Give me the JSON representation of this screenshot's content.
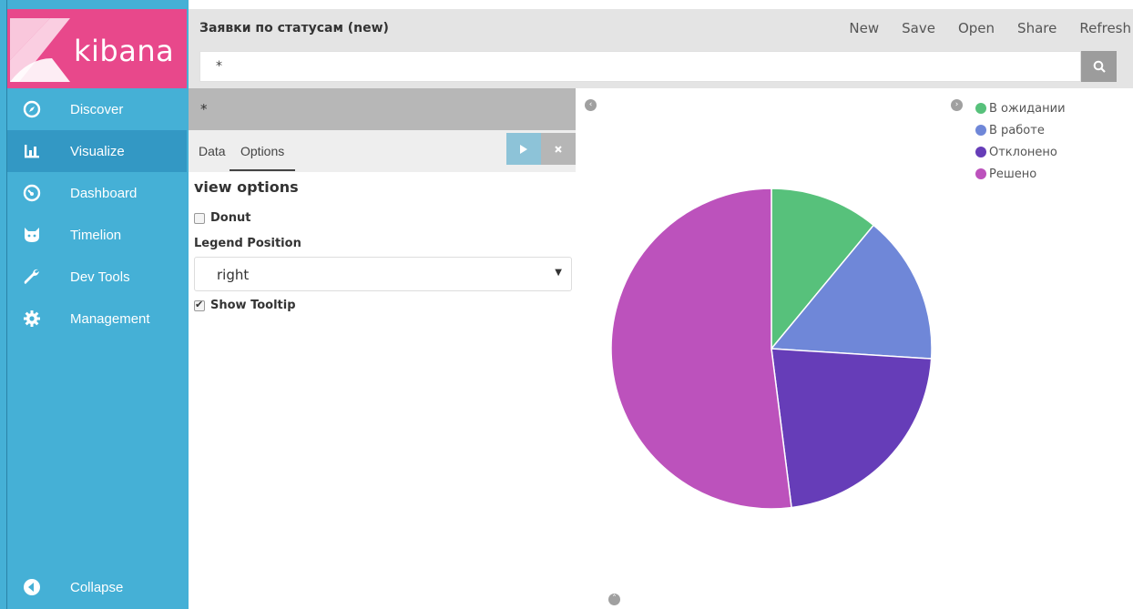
{
  "brand": {
    "name": "kibana"
  },
  "sidebar": {
    "items": [
      {
        "label": "Discover",
        "icon": "compass-icon"
      },
      {
        "label": "Visualize",
        "icon": "bar-chart-icon"
      },
      {
        "label": "Dashboard",
        "icon": "dashboard-gauge-icon"
      },
      {
        "label": "Timelion",
        "icon": "timelion-cat-icon"
      },
      {
        "label": "Dev Tools",
        "icon": "wrench-icon"
      },
      {
        "label": "Management",
        "icon": "gear-icon"
      }
    ],
    "active": "Visualize",
    "collapse_label": "Collapse"
  },
  "topbar": {
    "title": "Заявки по статусам (new)",
    "menu": {
      "new": "New",
      "save": "Save",
      "open": "Open",
      "share": "Share",
      "refresh": "Refresh"
    }
  },
  "search": {
    "value": "*"
  },
  "editor": {
    "query_label": "*",
    "tabs": {
      "data": "Data",
      "options": "Options"
    },
    "active_tab": "Options",
    "view_options_title": "view options",
    "donut_label": "Donut",
    "donut_checked": false,
    "legend_position_label": "Legend Position",
    "legend_position_value": "right",
    "show_tooltip_label": "Show Tooltip",
    "show_tooltip_checked": true
  },
  "colors": {
    "sidebar": "#45b0d6",
    "sidebar_active": "#3398c4",
    "logo": "#e8488b"
  },
  "chart_data": {
    "type": "pie",
    "legend_position": "top-right",
    "slices": [
      {
        "label": "В ожидании",
        "value": 11,
        "color": "#57c17b"
      },
      {
        "label": "В работе",
        "value": 15,
        "color": "#6f87d8"
      },
      {
        "label": "Отклонено",
        "value": 22,
        "color": "#663db8"
      },
      {
        "label": "Решено",
        "value": 52,
        "color": "#bc52bc"
      }
    ]
  }
}
